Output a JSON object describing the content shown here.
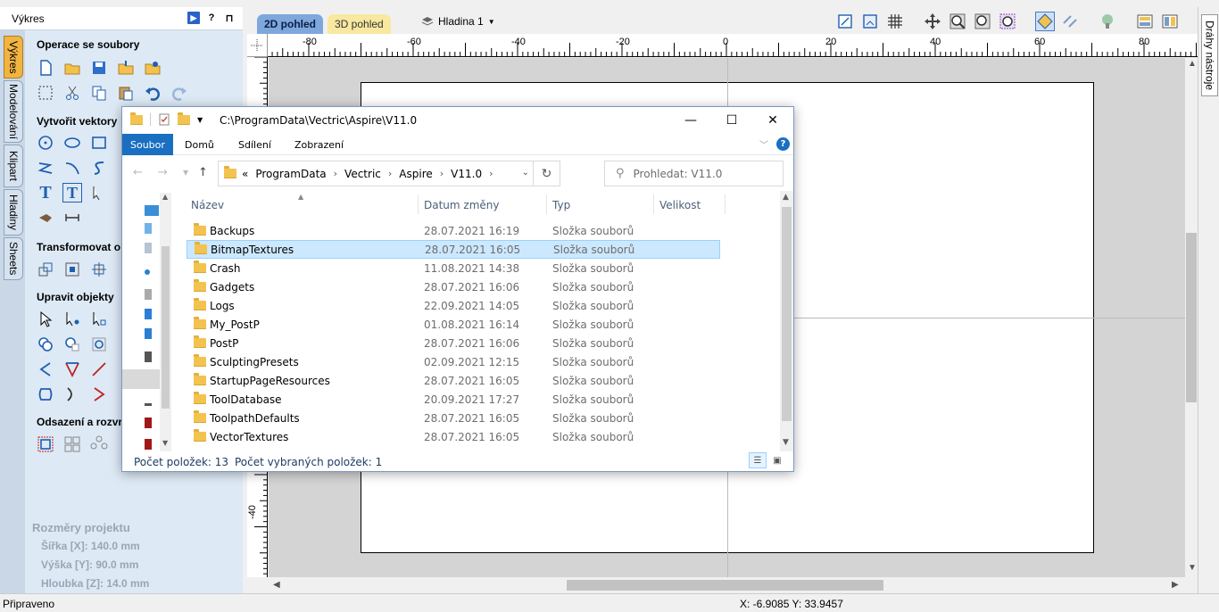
{
  "left_panel": {
    "title": "Výkres",
    "header_icons": [
      "?",
      "⊓"
    ],
    "vertical_tabs": [
      "Výkres",
      "Modelování",
      "Klipart",
      "Hladiny",
      "Sheets"
    ],
    "sections": {
      "file_ops": "Operace se soubory",
      "create_vectors": "Vytvořit vektory",
      "transform": "Transformovat o",
      "edit_objects": "Upravit objekty",
      "offset": "Odsazení a rozvr"
    },
    "project_info": {
      "heading": "Rozměry projektu",
      "width": "Šířka   [X]: 140.0 mm",
      "height": "Výška   [Y]: 90.0 mm",
      "depth": "Hloubka [Z]: 14.0 mm"
    }
  },
  "toolbar": {
    "tab_2d": "2D pohled",
    "tab_3d": "3D pohled",
    "layer": "Hladina 1"
  },
  "ruler": {
    "top_labels": [
      "-80",
      "-60",
      "-40",
      "-20",
      "0",
      "20",
      "40",
      "60",
      "80"
    ],
    "left_label": "-40"
  },
  "right_strip": {
    "tab": "Dráhy nástroje"
  },
  "status_bar": {
    "left": "Připraveno",
    "coords": "X: -6.9085 Y: 33.9457"
  },
  "explorer": {
    "title_path": "C:\\ProgramData\\Vectric\\Aspire\\V11.0",
    "win_buttons": {
      "min": "—",
      "max": "☐",
      "close": "✕"
    },
    "ribbon_tabs": [
      "Soubor",
      "Domů",
      "Sdílení",
      "Zobrazení"
    ],
    "help": "?",
    "address": {
      "prefix": "«",
      "crumbs": [
        "ProgramData",
        "Vectric",
        "Aspire",
        "V11.0"
      ]
    },
    "search_placeholder": "Prohledat: V11.0",
    "columns": [
      "Název",
      "Datum změny",
      "Typ",
      "Velikost"
    ],
    "files": [
      {
        "name": "Backups",
        "date": "28.07.2021 16:19",
        "type": "Složka souborů"
      },
      {
        "name": "BitmapTextures",
        "date": "28.07.2021 16:05",
        "type": "Složka souborů"
      },
      {
        "name": "Crash",
        "date": "11.08.2021 14:38",
        "type": "Složka souborů"
      },
      {
        "name": "Gadgets",
        "date": "28.07.2021 16:06",
        "type": "Složka souborů"
      },
      {
        "name": "Logs",
        "date": "22.09.2021 14:05",
        "type": "Složka souborů"
      },
      {
        "name": "My_PostP",
        "date": "01.08.2021 16:14",
        "type": "Složka souborů"
      },
      {
        "name": "PostP",
        "date": "28.07.2021 16:06",
        "type": "Složka souborů"
      },
      {
        "name": "SculptingPresets",
        "date": "02.09.2021 12:15",
        "type": "Složka souborů"
      },
      {
        "name": "StartupPageResources",
        "date": "28.07.2021 16:05",
        "type": "Složka souborů"
      },
      {
        "name": "ToolDatabase",
        "date": "20.09.2021 17:27",
        "type": "Složka souborů"
      },
      {
        "name": "ToolpathDefaults",
        "date": "28.07.2021 16:05",
        "type": "Složka souborů"
      },
      {
        "name": "VectorTextures",
        "date": "28.07.2021 16:05",
        "type": "Složka souborů"
      }
    ],
    "selected_index": 1,
    "status": {
      "count": "Počet položek: 13",
      "selected": "Počet vybraných položek: 1"
    }
  },
  "colors": {
    "panel_bg": "#dde9f5",
    "tab_active": "#f2b441",
    "tab_2d": "#7ea7dc",
    "tab_3d": "#f8e8a0",
    "icon_blue": "#1f5fb0",
    "explorer_accent": "#1a6fc1",
    "selection": "#cce8ff",
    "folder": "#f3c350"
  }
}
